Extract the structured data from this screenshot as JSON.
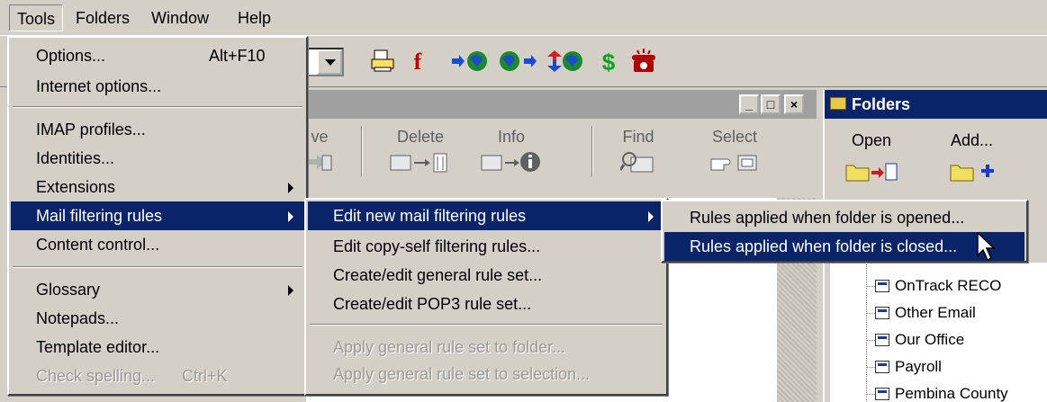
{
  "menubar": {
    "items": [
      {
        "label": "Tools"
      },
      {
        "label": "Folders"
      },
      {
        "label": "Window"
      },
      {
        "label": "Help"
      }
    ]
  },
  "toolbar": {
    "icons": [
      "printer-icon",
      "f-icon",
      "globe-send-icon",
      "globe-icon",
      "globe-receive-icon",
      "dollar-icon",
      "telephone-icon"
    ],
    "f_glyph": "f",
    "dollar_glyph": "$"
  },
  "message_window": {
    "buttons": [
      {
        "label": "ve"
      },
      {
        "label": "Delete"
      },
      {
        "label": "Info"
      },
      {
        "label": "Find"
      },
      {
        "label": "Select"
      }
    ],
    "minimize_glyph": "_",
    "maximize_glyph": "□",
    "close_glyph": "×"
  },
  "folders_panel": {
    "title": "Folders",
    "buttons": [
      {
        "label": "Open"
      },
      {
        "label": "Add..."
      }
    ],
    "tree": [
      {
        "label": "OnTrack RECO"
      },
      {
        "label": "Other Email"
      },
      {
        "label": "Our Office"
      },
      {
        "label": "Payroll"
      },
      {
        "label": "Pembina County"
      }
    ]
  },
  "tools_menu": {
    "items": [
      {
        "label": "Options...",
        "accel": "Alt+F10"
      },
      {
        "label": "Internet options..."
      },
      {
        "label": "IMAP profiles..."
      },
      {
        "label": "Identities..."
      },
      {
        "label": "Extensions"
      },
      {
        "label": "Mail filtering rules"
      },
      {
        "label": "Content control..."
      },
      {
        "label": "Glossary"
      },
      {
        "label": "Notepads..."
      },
      {
        "label": "Template editor..."
      },
      {
        "label": "Check spelling...",
        "accel": "Ctrl+K"
      }
    ]
  },
  "filtering_submenu": {
    "items": [
      {
        "label": "Edit new mail filtering rules"
      },
      {
        "label": "Edit copy-self filtering rules..."
      },
      {
        "label": "Create/edit general rule set..."
      },
      {
        "label": "Create/edit POP3 rule set..."
      },
      {
        "label": "Apply general rule set to folder..."
      },
      {
        "label": "Apply general rule set to selection..."
      }
    ]
  },
  "new_mail_submenu": {
    "items": [
      {
        "label": "Rules applied when folder is opened..."
      },
      {
        "label": "Rules applied when folder is closed..."
      }
    ]
  }
}
